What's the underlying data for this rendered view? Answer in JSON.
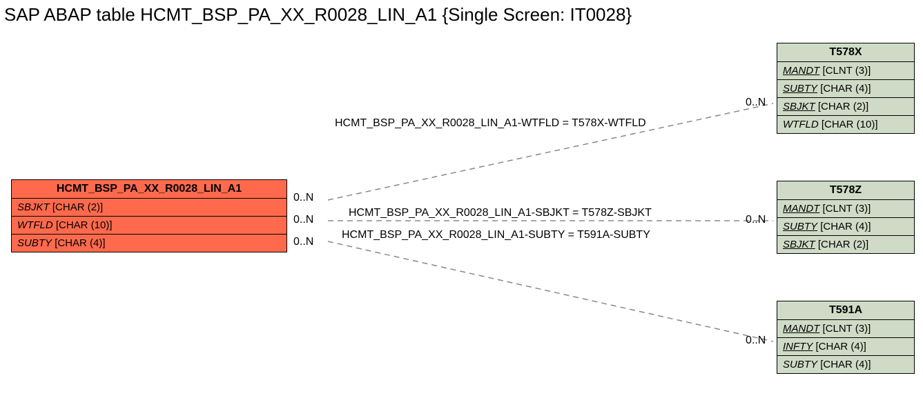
{
  "title": "SAP ABAP table HCMT_BSP_PA_XX_R0028_LIN_A1 {Single Screen: IT0028}",
  "main": {
    "name": "HCMT_BSP_PA_XX_R0028_LIN_A1",
    "fields": [
      {
        "name": "SBJKT",
        "type": "[CHAR (2)]"
      },
      {
        "name": "WTFLD",
        "type": "[CHAR (10)]"
      },
      {
        "name": "SUBTY",
        "type": "[CHAR (4)]"
      }
    ]
  },
  "t578x": {
    "name": "T578X",
    "fields": [
      {
        "name": "MANDT",
        "type": "[CLNT (3)]",
        "underline": true
      },
      {
        "name": "SUBTY",
        "type": "[CHAR (4)]",
        "underline": true
      },
      {
        "name": "SBJKT",
        "type": "[CHAR (2)]",
        "underline": true
      },
      {
        "name": "WTFLD",
        "type": "[CHAR (10)]"
      }
    ]
  },
  "t578z": {
    "name": "T578Z",
    "fields": [
      {
        "name": "MANDT",
        "type": "[CLNT (3)]",
        "underline": true
      },
      {
        "name": "SUBTY",
        "type": "[CHAR (4)]",
        "underline": true
      },
      {
        "name": "SBJKT",
        "type": "[CHAR (2)]",
        "underline": true
      }
    ]
  },
  "t591a": {
    "name": "T591A",
    "fields": [
      {
        "name": "MANDT",
        "type": "[CLNT (3)]",
        "underline": true
      },
      {
        "name": "INFTY",
        "type": "[CHAR (4)]",
        "underline": true
      },
      {
        "name": "SUBTY",
        "type": "[CHAR (4)]"
      }
    ]
  },
  "rel1": {
    "label": "HCMT_BSP_PA_XX_R0028_LIN_A1-WTFLD = T578X-WTFLD",
    "leftCard": "0..N",
    "rightCard": "0..N"
  },
  "rel2": {
    "label": "HCMT_BSP_PA_XX_R0028_LIN_A1-SBJKT = T578Z-SBJKT",
    "leftCard": "0..N",
    "rightCard": "0..N"
  },
  "rel3": {
    "label": "HCMT_BSP_PA_XX_R0028_LIN_A1-SUBTY = T591A-SUBTY",
    "leftCard": "0..N",
    "rightCard": "0..N"
  }
}
